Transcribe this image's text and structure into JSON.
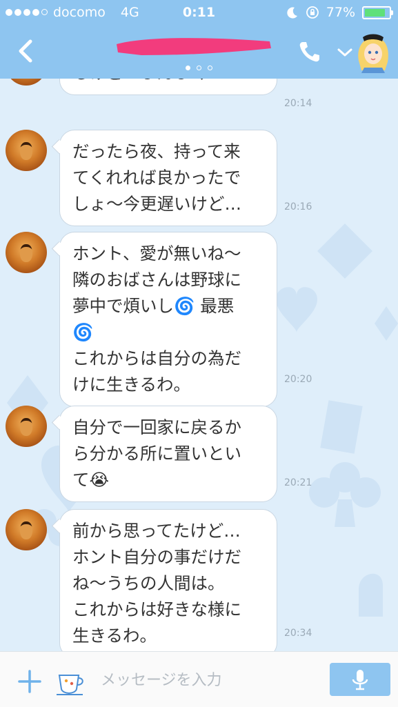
{
  "status_bar": {
    "carrier": "docomo",
    "network": "4G",
    "time": "0:11",
    "battery": "77%",
    "battery_level": 0.77,
    "signal_bars": 4
  },
  "header": {
    "page_dots": 3,
    "active_dot": 0,
    "colors": {
      "header": "#8ec5f0",
      "redaction": "#f23c7d"
    }
  },
  "messages": [
    {
      "text": "るけど…ぷんぷく",
      "time": "20:14"
    },
    {
      "text": "だったら夜、持って来\nてくれれば良かったで\nしょ〜今更遅いけど…",
      "time": "20:16"
    },
    {
      "text": "ホント、愛が無いね〜\n隣のおばさんは野球に\n夢中で煩いし🌀 最悪\n🌀\nこれからは自分の為だ\nけに生きるわ。",
      "time": "20:20"
    },
    {
      "text": "自分で一回家に戻るか\nら分かる所に置いとい\nて😭",
      "time": "20:21"
    },
    {
      "text": "前から思ってたけど…\nホント自分の事だけだ\nね〜うちの人間は。\nこれからは好きな様に\n生きるわ。",
      "time": "20:34"
    }
  ],
  "input": {
    "placeholder": "メッセージを入力",
    "value": ""
  },
  "icons": {
    "back": "chevron-left-icon",
    "call": "phone-icon",
    "menu": "chevron-down-icon",
    "add": "plus-icon",
    "sticker": "teacup-icon",
    "mic": "microphone-icon"
  }
}
